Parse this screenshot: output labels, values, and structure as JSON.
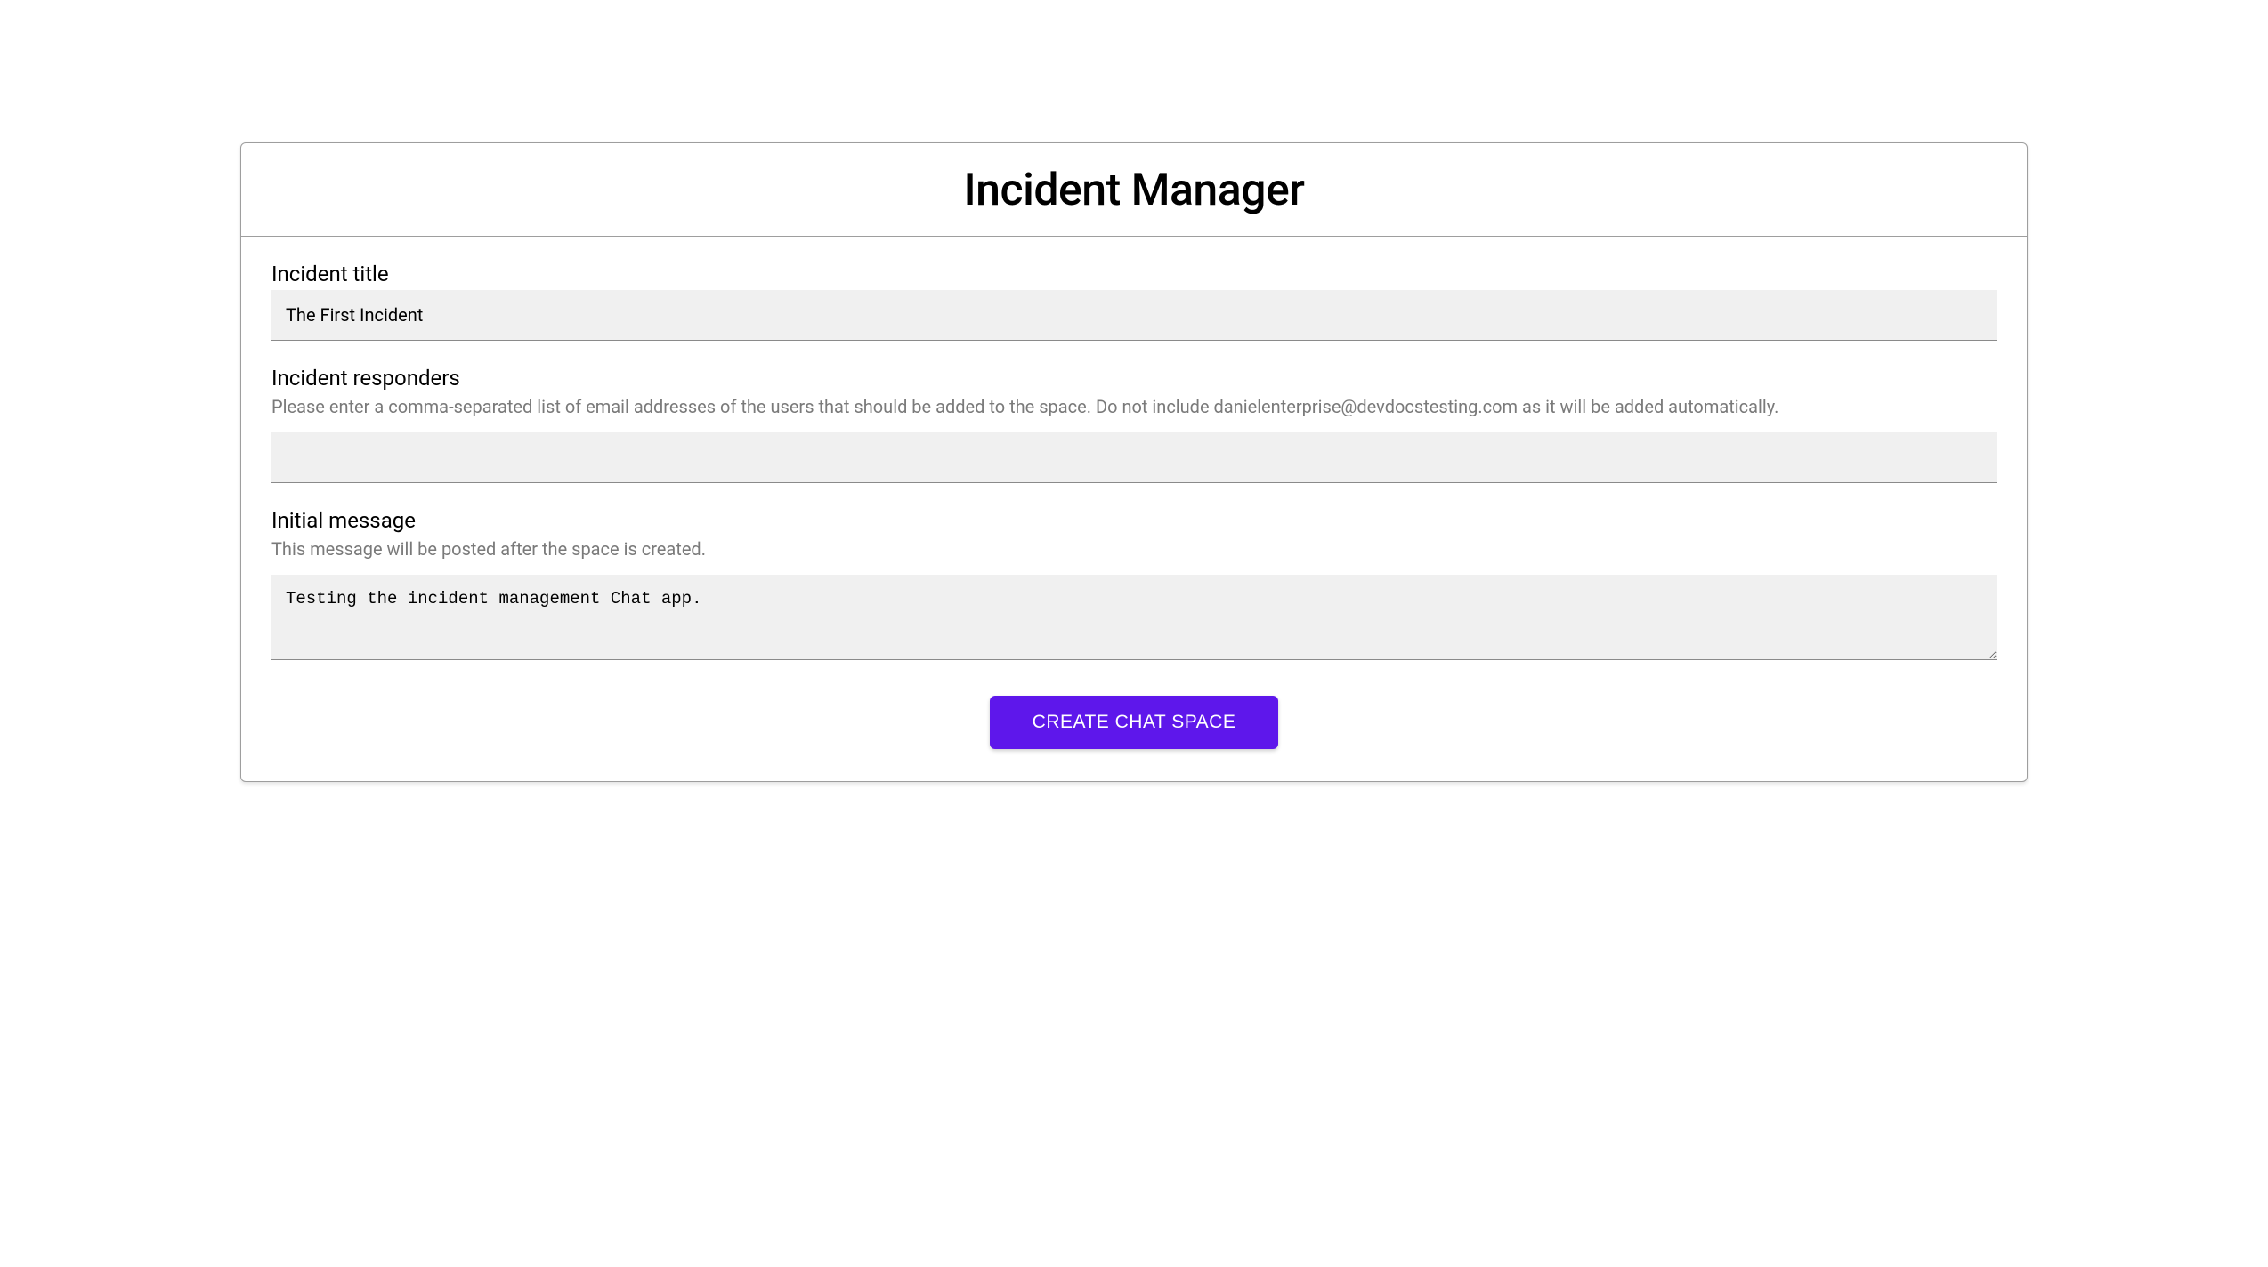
{
  "header": {
    "title": "Incident Manager"
  },
  "fields": {
    "incident_title": {
      "label": "Incident title",
      "value": "The First Incident"
    },
    "incident_responders": {
      "label": "Incident responders",
      "hint": "Please enter a comma-separated list of email addresses of the users that should be added to the space. Do not include danielenterprise@devdocstesting.com as it will be added automatically.",
      "value": ""
    },
    "initial_message": {
      "label": "Initial message",
      "hint": "This message will be posted after the space is created.",
      "value": "Testing the incident management Chat app."
    }
  },
  "actions": {
    "create_label": "CREATE CHAT SPACE"
  }
}
